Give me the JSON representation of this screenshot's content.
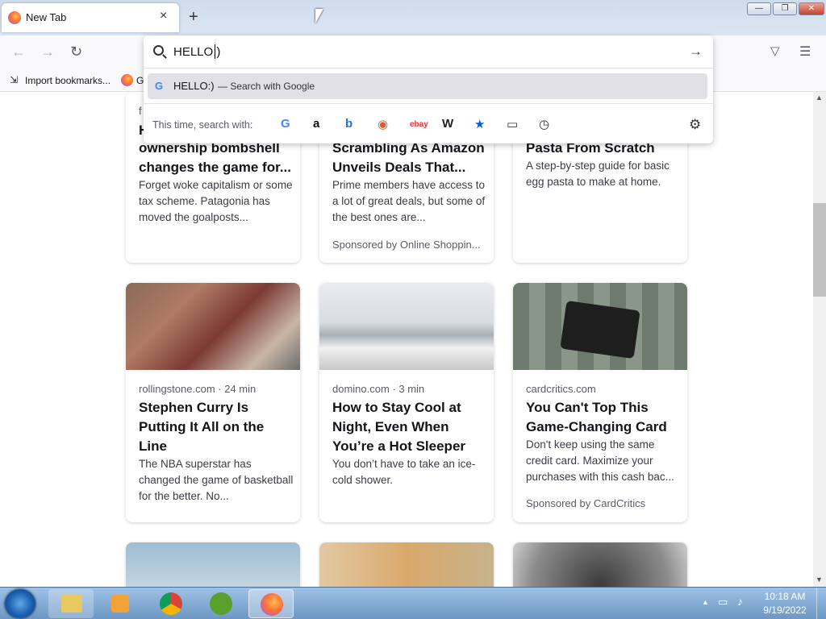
{
  "browser": {
    "tab_title": "New Tab",
    "tab_close_icon": "×",
    "new_tab_icon": "+",
    "bookmarks": {
      "import_label": "Import bookmarks...",
      "partial_label": "G"
    }
  },
  "window_controls": {
    "minimize": "—",
    "restore": "❐",
    "close": "✕"
  },
  "nav": {
    "back_icon": "←",
    "forward_icon": "→",
    "reload_icon": "↻",
    "pocket_icon": "▽",
    "menu_icon": "☰"
  },
  "urlbar": {
    "value": "HELLO:)",
    "go_icon": "→",
    "suggestion_text": "HELLO:)",
    "suggestion_suffix": "— Search with Google",
    "search_with_label": "This time, search with:",
    "engines": [
      {
        "name": "google-engine",
        "glyph": "G",
        "color": "#4285f4"
      },
      {
        "name": "amazon-engine",
        "glyph": "a",
        "color": "#111111"
      },
      {
        "name": "bing-engine",
        "glyph": "b",
        "color": "#1a73e8"
      },
      {
        "name": "duckduckgo-engine",
        "glyph": "◉",
        "color": "#de5833"
      },
      {
        "name": "ebay-engine",
        "glyph": "ebay",
        "color": "#e53238"
      },
      {
        "name": "wikipedia-engine",
        "glyph": "W",
        "color": "#222222"
      },
      {
        "name": "bookmarks-engine",
        "glyph": "★",
        "color": "#0060df"
      },
      {
        "name": "tabs-engine",
        "glyph": "▭",
        "color": "#333333"
      },
      {
        "name": "history-engine",
        "glyph": "◷",
        "color": "#333333"
      }
    ],
    "settings_icon": "⚙"
  },
  "cards_row1": [
    {
      "source": "f",
      "headline_partial": "H",
      "headline": "ownership bombshell changes the game for...",
      "desc": "Forget woke capitalism or some tax scheme. Patagonia has moved the goalposts...",
      "sponsor": ""
    },
    {
      "source": "",
      "headline": "Scrambling As Amazon Unveils Deals That...",
      "desc": "Prime members have access to a lot of great deals, but some of the best ones are...",
      "sponsor": "Sponsored by Online Shoppin..."
    },
    {
      "source": "",
      "headline": "Pasta From Scratch",
      "desc": "A step-by-step guide for basic egg pasta to make at home.",
      "sponsor": ""
    }
  ],
  "cards_row2": [
    {
      "source": "rollingstone.com · 24 min",
      "headline": "Stephen Curry Is Putting It All on the Line",
      "desc": "The NBA superstar has changed the game of basketball for the better. No...",
      "sponsor": ""
    },
    {
      "source": "domino.com · 3 min",
      "headline": "How to Stay Cool at Night, Even When You’re a Hot Sleeper",
      "desc": "You don’t have to take an ice-cold shower.",
      "sponsor": ""
    },
    {
      "source": "cardcritics.com",
      "headline": "You Can't Top This Game-Changing Card",
      "desc": "Don't keep using the same credit card. Maximize your purchases with this cash bac...",
      "sponsor": "Sponsored by CardCritics"
    }
  ],
  "taskbar": {
    "time": "10:18 AM",
    "date": "9/19/2022",
    "apps": [
      "explorer",
      "media-player",
      "chrome",
      "utorrent",
      "firefox"
    ]
  }
}
